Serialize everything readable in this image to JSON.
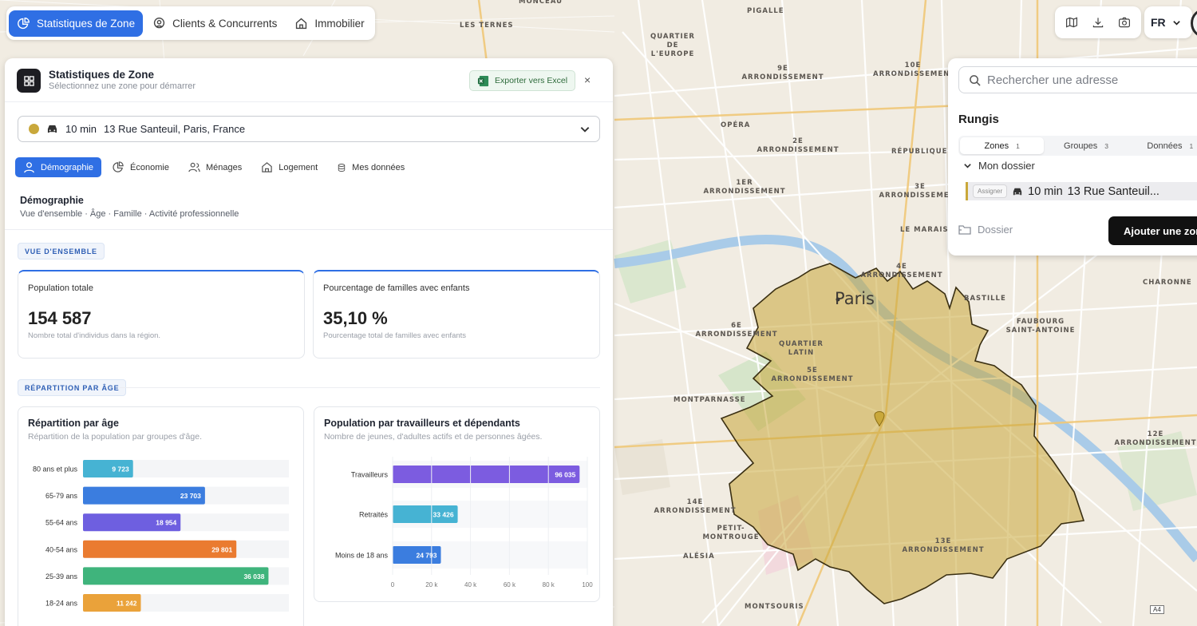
{
  "nav": {
    "tabs": [
      {
        "label": "Statistiques de Zone",
        "icon": "chart-pie-icon",
        "active": true
      },
      {
        "label": "Clients & Concurrents",
        "icon": "map-pin-icon",
        "active": false
      },
      {
        "label": "Immobilier",
        "icon": "home-icon",
        "active": false
      }
    ],
    "language": "FR"
  },
  "map": {
    "city_label": "Paris",
    "road_marker": "A4",
    "labels": [
      "LES TERNES",
      "PIGALLE",
      "QUARTIER DE L'EUROPE",
      "9E ARRONDISSEMENT",
      "10E ARRONDISSEMENT",
      "OPÉRA",
      "2E ARRONDISSEMENT",
      "RÉPUBLIQUE",
      "1ER ARRONDISSEMENT",
      "3E ARRONDISSEMENT",
      "LE MARAIS",
      "4E ARRONDISSEMENT",
      "BASTILLE",
      "CHARONNE",
      "FAUBOURG SAINT-ANTOINE",
      "6E ARRONDISSEMENT",
      "QUARTIER LATIN",
      "5E ARRONDISSEMENT",
      "MONTPARNASSE",
      "12E ARRONDISSEMENT",
      "14E ARRONDISSEMENT",
      "PETIT-MONTROUGE",
      "ALÉSIA",
      "13E ARRONDISSEMENT",
      "MONTSOURIS",
      "MONCEAU",
      "ARRONDISSEMENT"
    ]
  },
  "panel": {
    "title": "Statistiques de Zone",
    "subtitle": "Sélectionnez une zone pour démarrer",
    "export_label": "Exporter vers Excel",
    "close_label": "×",
    "zone": {
      "duration": "10 min",
      "address": "13 Rue Santeuil, Paris, France",
      "color": "#c9a83b"
    },
    "tabs": [
      {
        "label": "Démographie",
        "active": true
      },
      {
        "label": "Économie",
        "active": false
      },
      {
        "label": "Ménages",
        "active": false
      },
      {
        "label": "Logement",
        "active": false
      },
      {
        "label": "Mes données",
        "active": false
      }
    ],
    "section_title": "Démographie",
    "section_sub": "Vue d'ensemble · Âge · Famille · Activité professionnelle",
    "overview_pill": "VUE D'ENSEMBLE",
    "kpis": [
      {
        "label": "Population totale",
        "value": "154 587",
        "desc": "Nombre total d'individus dans la région."
      },
      {
        "label": "Pourcentage de familles avec enfants",
        "value": "35,10 %",
        "desc": "Pourcentage total de familles avec enfants"
      }
    ],
    "age_pill": "RÉPARTITION PAR ÂGE",
    "age_card": {
      "title": "Répartition par âge",
      "subtitle": "Répartition de la population par groupes d'âge."
    },
    "workers_card": {
      "title": "Population par travailleurs et dépendants",
      "subtitle": "Nombre de jeunes, d'adultes actifs et de personnes âgées."
    }
  },
  "chart_data": [
    {
      "type": "bar",
      "orientation": "horizontal",
      "title": "Répartition par âge",
      "categories": [
        "80 ans et plus",
        "65-79 ans",
        "55-64 ans",
        "40-54 ans",
        "25-39 ans",
        "18-24 ans"
      ],
      "values": [
        9723,
        23703,
        18954,
        29801,
        36038,
        11242
      ],
      "value_labels": [
        "9 723",
        "23 703",
        "18 954",
        "29 801",
        "36 038",
        "11 242"
      ],
      "colors": [
        "#46b3d3",
        "#3b7ddf",
        "#6e5fe0",
        "#ea7b30",
        "#3fb47c",
        "#eaa23a"
      ],
      "xlim": [
        0,
        40000
      ]
    },
    {
      "type": "bar",
      "orientation": "horizontal",
      "title": "Population par travailleurs et dépendants",
      "categories": [
        "Travailleurs",
        "Retraités",
        "Moins de 18 ans"
      ],
      "values": [
        96035,
        33426,
        24793
      ],
      "value_labels": [
        "96 035",
        "33 426",
        "24 793"
      ],
      "colors": [
        "#7c5ce0",
        "#46b3d3",
        "#3b7ddf"
      ],
      "xlim": [
        0,
        100000
      ],
      "xticks": [
        "0",
        "20 k",
        "40 k",
        "60 k",
        "80 k",
        "100"
      ]
    }
  ],
  "right_panel": {
    "search_placeholder": "Rechercher une adresse",
    "title": "Rungis",
    "tabs": [
      {
        "label": "Zones",
        "count": "1",
        "active": true
      },
      {
        "label": "Groupes",
        "count": "3",
        "active": false
      },
      {
        "label": "Données",
        "count": "1",
        "active": false
      }
    ],
    "folder_label": "Mon dossier",
    "zone_row": {
      "assign": "Assigner",
      "duration": "10 min",
      "address": "13 Rue Santeuil..."
    },
    "dossier_label": "Dossier",
    "add_zone_label": "Ajouter une zone"
  }
}
